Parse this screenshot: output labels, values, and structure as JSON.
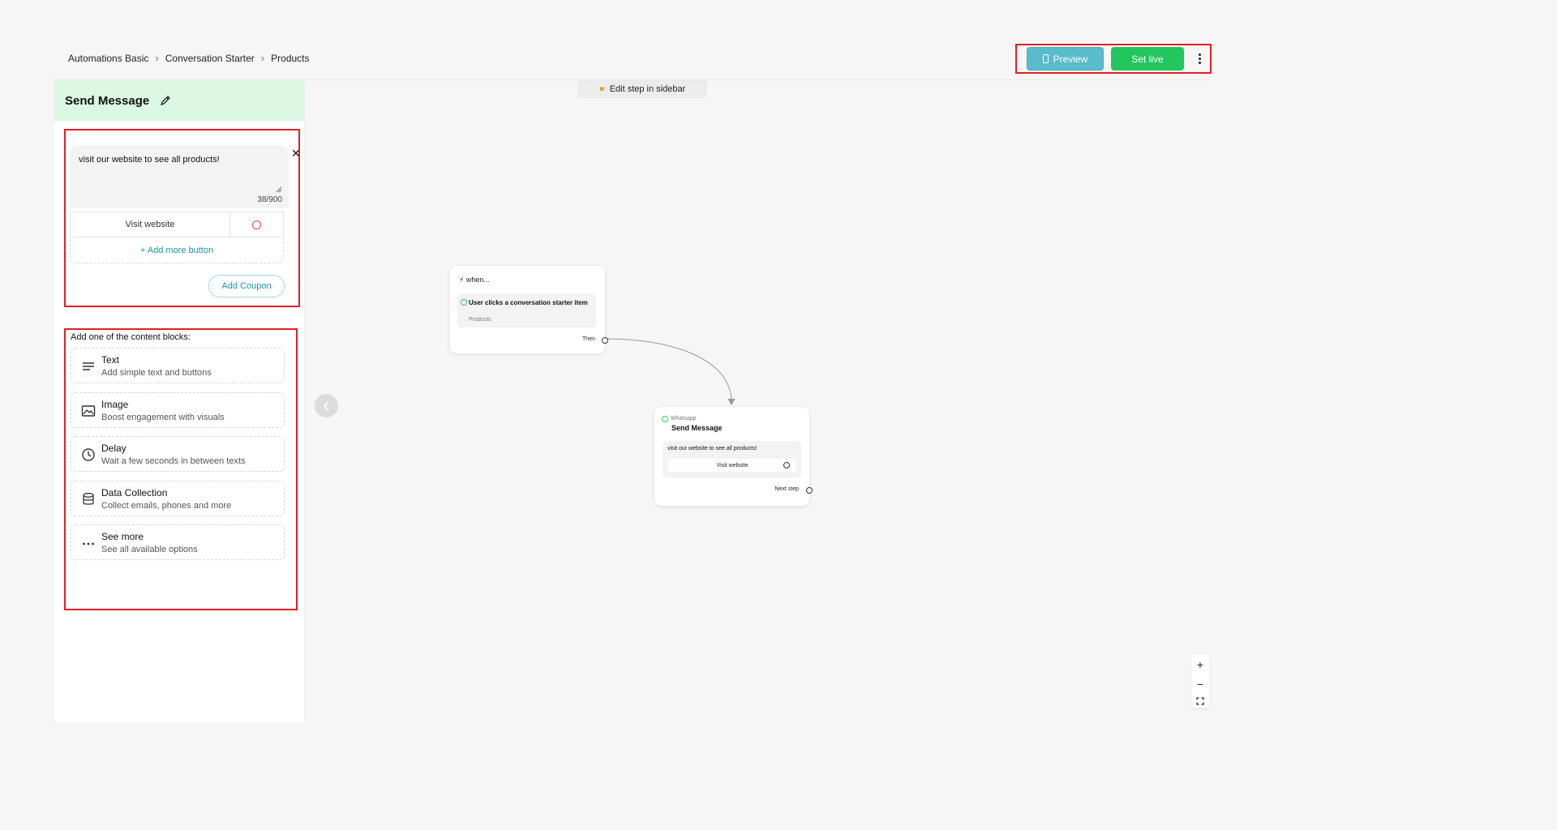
{
  "breadcrumb": {
    "items": [
      "Automations Basic",
      "Conversation Starter",
      "Products"
    ]
  },
  "header": {
    "preview_label": "Preview",
    "set_live_label": "Set live"
  },
  "sidebar": {
    "title": "Send Message",
    "message": {
      "text": "visit our website to see all products!",
      "char_count": "38/900",
      "button_label": "Visit website",
      "add_more_label": "+ Add more button",
      "add_coupon_label": "Add Coupon"
    },
    "content_blocks": {
      "heading": "Add one of the content blocks:",
      "items": [
        {
          "title": "Text",
          "desc": "Add simple text and buttons",
          "icon": "text-lines-icon"
        },
        {
          "title": "Image",
          "desc": "Boost engagement with visuals",
          "icon": "image-icon"
        },
        {
          "title": "Delay",
          "desc": "Wait a few seconds in between texts",
          "icon": "clock-icon"
        },
        {
          "title": "Data Collection",
          "desc": "Collect emails, phones and more",
          "icon": "database-icon"
        },
        {
          "title": "See more",
          "desc": "See all available options",
          "icon": "more-dots-icon"
        }
      ]
    }
  },
  "canvas": {
    "edit_hint": "Edit step in sidebar",
    "trigger": {
      "when_label": "when...",
      "text": "User clicks a conversation starter item",
      "sub": "Products",
      "then_label": "Then"
    },
    "send_node": {
      "channel": "Whatsapp",
      "title": "Send Message",
      "text": "visit our website to see all products!",
      "button_label": "Visit website",
      "next_label": "Next step"
    }
  },
  "colors": {
    "highlight": "#e41e26",
    "preview": "#58bccb",
    "live": "#22c55e",
    "accent": "#1797a6",
    "sidebar_head": "#dcf8e5"
  }
}
